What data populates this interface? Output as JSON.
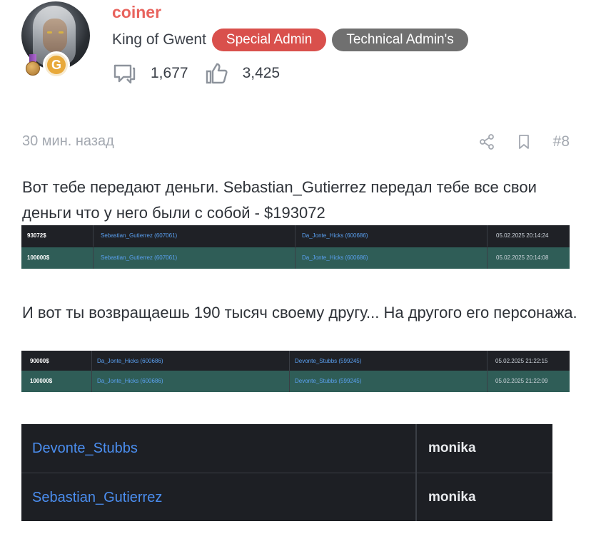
{
  "user": {
    "name": "coiner",
    "title": "King of Gwent",
    "badges": [
      "Special Admin",
      "Technical Admin's"
    ],
    "stats": {
      "messages": "1,677",
      "reactions": "3,425"
    },
    "badge_letter": "G"
  },
  "post": {
    "time": "30 мин. назад",
    "number": "#8",
    "text1": "Вот тебе передают деньги. Sebastian_Gutierrez передал тебе все свои деньги что у него были с собой - $193072",
    "text2": "И вот ты возвращаешь 190 тысяч своему другу... На другого его персонажа."
  },
  "transactions1": [
    {
      "amount": "93072$",
      "from": "Sebastian_Gutierrez (607061)",
      "to": "Da_Jonte_Hicks (600686)",
      "date": "05.02.2025 20:14:24"
    },
    {
      "amount": "100000$",
      "from": "Sebastian_Gutierrez (607061)",
      "to": "Da_Jonte_Hicks (600686)",
      "date": "05.02.2025 20:14:08"
    }
  ],
  "transactions2": [
    {
      "amount": "90000$",
      "from": "Da_Jonte_Hicks (600686)",
      "to": "Devonte_Stubbs (599245)",
      "date": "05.02.2025 21:22:15"
    },
    {
      "amount": "100000$",
      "from": "Da_Jonte_Hicks (600686)",
      "to": "Devonte_Stubbs (599245)",
      "date": "05.02.2025 21:22:09"
    }
  ],
  "accounts": [
    {
      "name": "Devonte_Stubbs",
      "owner": "monika"
    },
    {
      "name": "Sebastian_Gutierrez",
      "owner": "monika"
    }
  ],
  "colors": {
    "username": "#e8635d",
    "special_admin": "#d9504c",
    "technical_admin": "#707070",
    "table_bg": "#1f2126",
    "row_highlight": "#2f5d57",
    "link": "#4b8ef0"
  }
}
